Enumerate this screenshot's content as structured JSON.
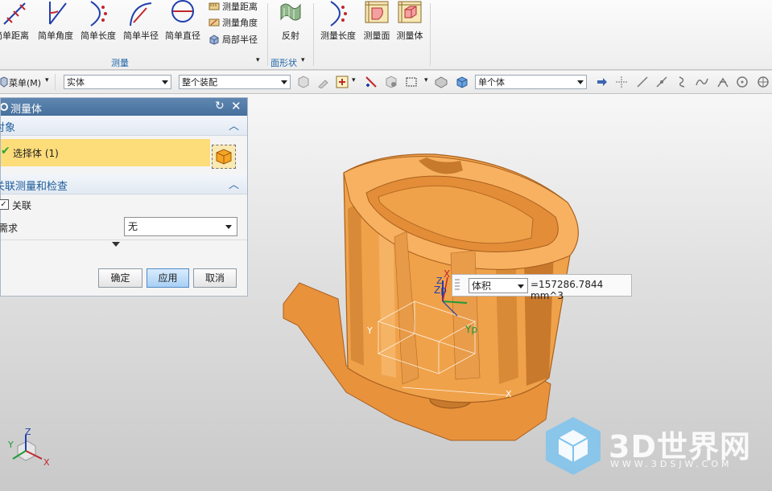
{
  "ribbon": {
    "buttons": [
      {
        "label": "简单距离"
      },
      {
        "label": "简单角度"
      },
      {
        "label": "简单长度"
      },
      {
        "label": "简单半径"
      },
      {
        "label": "简单直径"
      }
    ],
    "small_items": [
      {
        "label": "测量距离"
      },
      {
        "label": "测量角度"
      },
      {
        "label": "局部半径"
      }
    ],
    "group_measure": "测量",
    "reflect": "反射",
    "group_surface": "面形状",
    "group_buttons": [
      {
        "label": "测量长度"
      },
      {
        "label": "测量面"
      },
      {
        "label": "测量体"
      }
    ]
  },
  "toolbar": {
    "menu": "菜单(M)",
    "filter_type": "实体",
    "assembly_scope": "整个装配",
    "body_rule": "单个体"
  },
  "dialog": {
    "title": "测量体",
    "section_object": "对象",
    "select_body": "选择体 (1)",
    "section_assoc": "关联测量和检查",
    "assoc_label": "关联",
    "assoc_checked": true,
    "requirement_label": "需求",
    "requirement_value": "无",
    "ok": "确定",
    "apply": "应用",
    "cancel": "取消"
  },
  "result": {
    "type": "体积",
    "value": "=157286.7844 mm^3"
  },
  "axes": {
    "x": "X",
    "y": "Y",
    "z": "Z",
    "xp": "X",
    "yp": "Yp",
    "zp": "Zp"
  },
  "watermark": {
    "brand": "3D世界网",
    "url": "WWW.3DSJW.COM"
  },
  "colors": {
    "part": "#f0a24a",
    "part_dark": "#c8762a",
    "accent": "#1d63a8",
    "highlight": "#fddc7a"
  }
}
